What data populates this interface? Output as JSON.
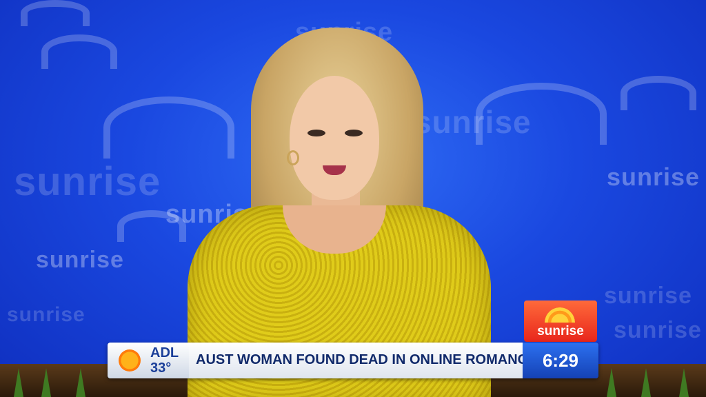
{
  "scene": {
    "description_brand": "sunrise",
    "colors": {
      "backdrop": "#1a48e0",
      "dress": "#e0cc1a",
      "brand_red": "#e8261c",
      "clock_blue": "#1542b5"
    }
  },
  "watermark": {
    "brand_word": "sunrise"
  },
  "lower_third": {
    "brand_label": "sunrise",
    "weather_city": "ADL",
    "weather_temp": "33°",
    "weather_icon": "sun-icon",
    "headline": "AUST WOMAN FOUND DEAD IN ONLINE ROMANCE SCAM",
    "time": "6:29"
  }
}
